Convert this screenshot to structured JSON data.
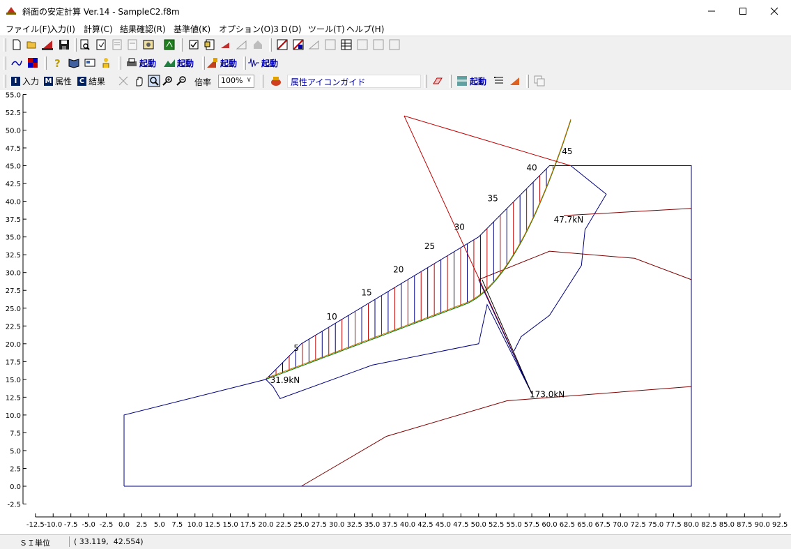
{
  "window": {
    "title": "斜面の安定計算 Ver.14 - SampleC2.f8m"
  },
  "menu": [
    "ファイル(F)",
    "入力(I)",
    "計算(C)",
    "結果確認(R)",
    "基準値(K)",
    "オプション(O)",
    "３Ｄ(D)",
    "ツール(T)",
    "ヘルプ(H)"
  ],
  "toolbar": {
    "kidou": "起動",
    "mode_input": "入力",
    "mode_attr": "属性",
    "mode_result": "結果",
    "mode_input_key": "I",
    "mode_attr_key": "M",
    "mode_result_key": "C",
    "zoom_label": "倍率",
    "zoom_value": "100%",
    "guide_text": "属性アイコンガイド"
  },
  "status": {
    "unit": "ＳＩ単位",
    "coords": "( 33.119,  42.554)"
  },
  "colors": {
    "blue_line": "#000080",
    "red_line": "#c00000",
    "dark_red": "#800000",
    "green": "#008000"
  },
  "chart_data": {
    "type": "slope-stability-plot",
    "xlim": [
      -12.5,
      92.5
    ],
    "ylim": [
      -2.5,
      55
    ],
    "x_ticks": [
      -12.5,
      -10,
      -7.5,
      -5,
      -2.5,
      0,
      2.5,
      5,
      7.5,
      10,
      12.5,
      15,
      17.5,
      20,
      22.5,
      25,
      27.5,
      30,
      32.5,
      35,
      37.5,
      40,
      42.5,
      45,
      47.5,
      50,
      52.5,
      55,
      57.5,
      60,
      62.5,
      65,
      67.5,
      70,
      72.5,
      75,
      77.5,
      80,
      82.5,
      85,
      87.5,
      90,
      92.5
    ],
    "y_ticks": [
      -2.5,
      0,
      2.5,
      5,
      7.5,
      10,
      12.5,
      15,
      17.5,
      20,
      22.5,
      25,
      27.5,
      30,
      32.5,
      35,
      37.5,
      40,
      42.5,
      45,
      47.5,
      50,
      52.5,
      55
    ],
    "outline": [
      [
        0,
        0
      ],
      [
        0,
        10
      ],
      [
        20,
        15
      ],
      [
        25,
        20
      ],
      [
        50,
        35
      ],
      [
        60,
        45
      ],
      [
        80,
        45
      ],
      [
        80,
        0
      ],
      [
        0,
        0
      ]
    ],
    "soil_layer_1": [
      [
        50,
        29
      ],
      [
        60,
        33
      ],
      [
        72,
        32
      ],
      [
        80,
        29
      ]
    ],
    "soil_layer_2": [
      [
        62,
        38
      ],
      [
        80,
        39
      ]
    ],
    "soil_layer_3": [
      [
        25,
        0
      ],
      [
        37,
        7
      ],
      [
        54,
        12
      ],
      [
        80,
        14
      ]
    ],
    "slice_numbers": [
      {
        "label": "5",
        "x": 24.3,
        "y": 19.0
      },
      {
        "label": "10",
        "x": 29.3,
        "y": 23.4
      },
      {
        "label": "15",
        "x": 34.2,
        "y": 26.8
      },
      {
        "label": "20",
        "x": 38.7,
        "y": 30.0
      },
      {
        "label": "25",
        "x": 43.1,
        "y": 33.3
      },
      {
        "label": "30",
        "x": 47.3,
        "y": 36.0
      },
      {
        "label": "35",
        "x": 52.0,
        "y": 40.0
      },
      {
        "label": "40",
        "x": 57.5,
        "y": 44.3
      },
      {
        "label": "45",
        "x": 62.5,
        "y": 46.6
      }
    ],
    "force_labels": [
      {
        "label": "31.9kN",
        "x": 20.6,
        "y": 14.5
      },
      {
        "label": "47.7kN",
        "x": 60.6,
        "y": 37.0
      },
      {
        "label": "173.0kN",
        "x": 57.2,
        "y": 12.5
      }
    ]
  }
}
